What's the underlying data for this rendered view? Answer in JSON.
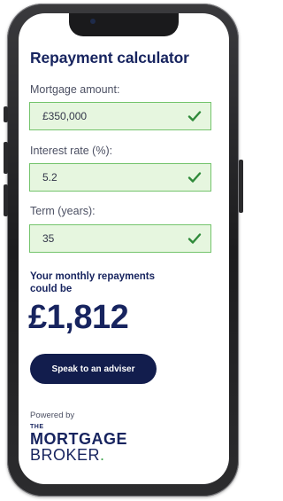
{
  "calculator": {
    "title": "Repayment calculator",
    "fields": [
      {
        "label": "Mortgage amount:",
        "value": "£350,000",
        "icon": "check-icon"
      },
      {
        "label": "Interest rate (%):",
        "value": "5.2",
        "icon": "check-icon"
      },
      {
        "label": "Term (years):",
        "value": "35",
        "icon": "check-icon"
      }
    ],
    "result_label": "Your monthly repayments could be",
    "result_value": "£1,812",
    "adviser_button": "Speak to an adviser",
    "powered_by": "Powered by",
    "logo": {
      "the": "THE",
      "line1": "MORTGAGE",
      "line2": "BROKER",
      "dot": "."
    }
  },
  "colors": {
    "primary": "#17245f",
    "button_bg": "#121d4d",
    "field_bg": "#e6f6df",
    "field_border": "#74c46c",
    "check": "#2f8a3a",
    "accent_dot": "#3fa34d"
  }
}
